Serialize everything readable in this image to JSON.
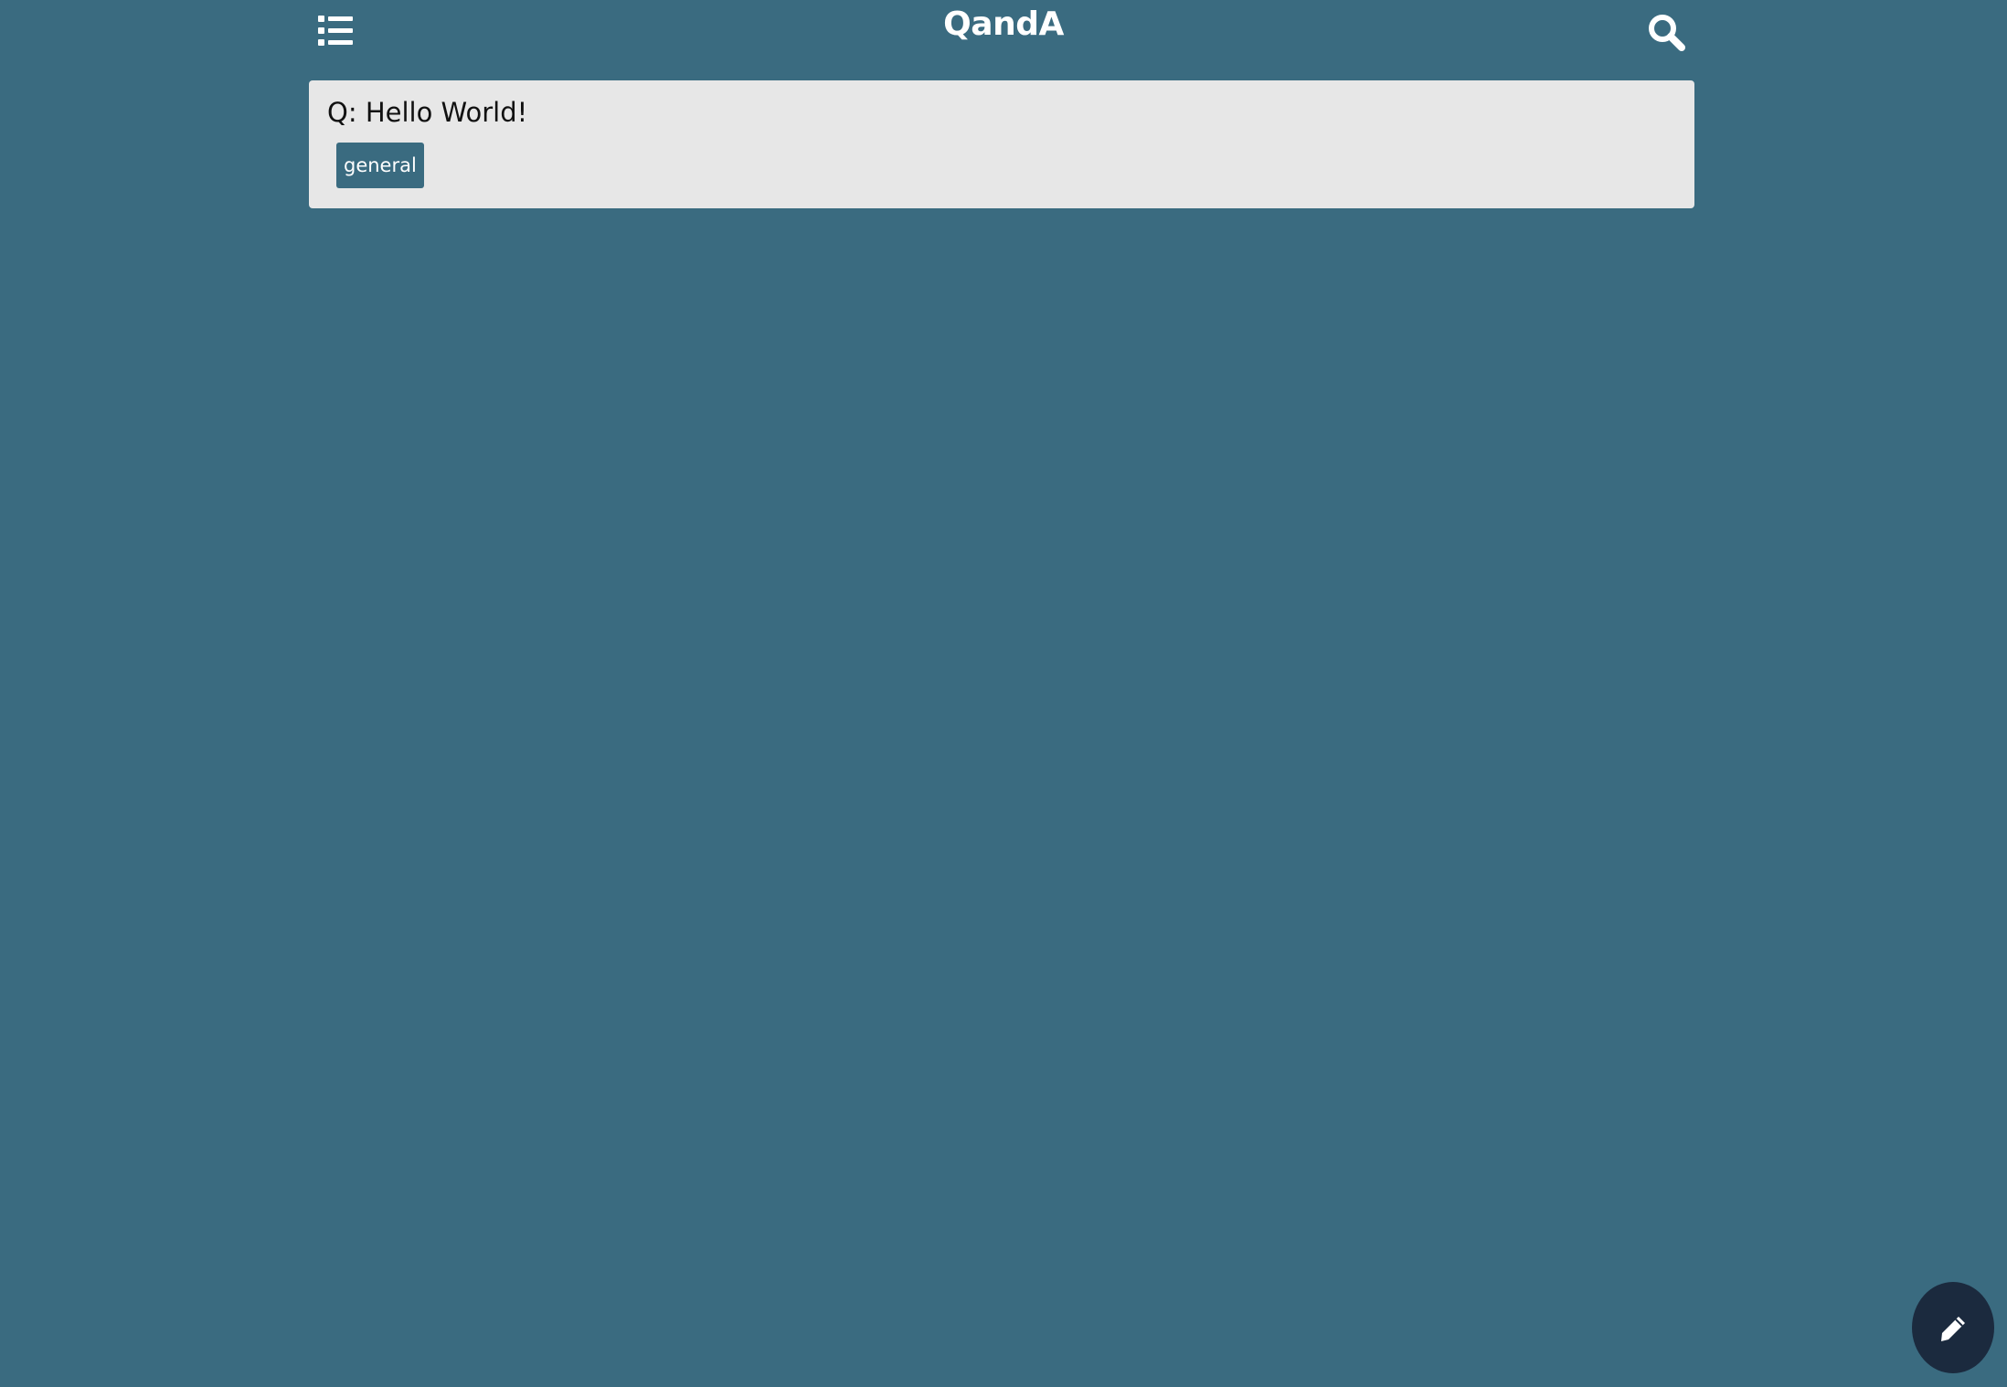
{
  "header": {
    "title": "QandA",
    "menu_icon": "list-icon",
    "search_icon": "search-icon"
  },
  "questions": [
    {
      "text": "Q: Hello World!",
      "tags": [
        "general"
      ]
    }
  ],
  "fab": {
    "icon": "pencil-icon"
  },
  "colors": {
    "background": "#3a6b80",
    "card": "#e7e7e7",
    "tag": "#3a6b80",
    "fab": "#1b2a3e",
    "title": "#ffffff"
  }
}
